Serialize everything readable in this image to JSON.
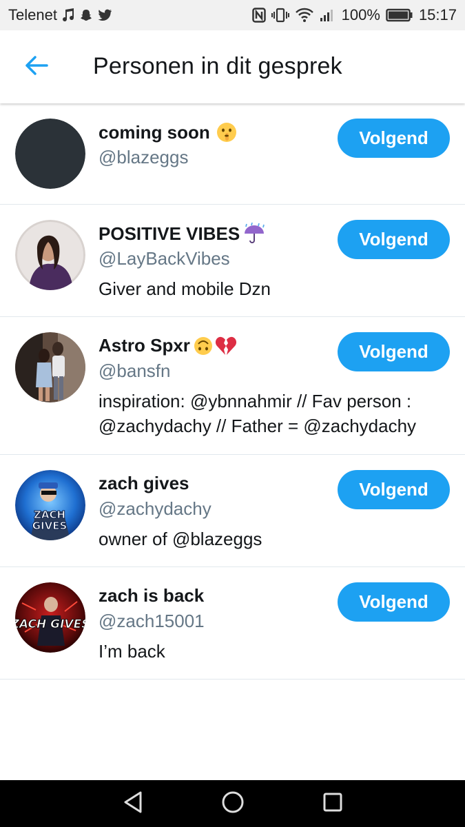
{
  "status_bar": {
    "carrier": "Telenet",
    "battery": "100%",
    "time": "15:17",
    "left_icons": [
      "music-note-icon",
      "snapchat-icon",
      "twitter-icon"
    ],
    "right_icons": [
      "nfc-icon",
      "vibrate-icon",
      "wifi-icon",
      "signal-icon",
      "battery-icon"
    ]
  },
  "header": {
    "back_icon": "arrow-left-icon",
    "title": "Personen in dit gesprek"
  },
  "colors": {
    "accent": "#1da1f2",
    "text_primary": "#14171a",
    "text_secondary": "#657786",
    "divider": "#e1e8ed"
  },
  "people": [
    {
      "name": "coming soon",
      "name_emoji": "shushing-face-emoji",
      "handle": "@blazeggs",
      "bio": "",
      "follow_label": "Volgend",
      "avatar": "dark-circle-avatar"
    },
    {
      "name": "POSITIVE VIBES",
      "name_emoji": "umbrella-rain-emoji",
      "handle": "@LayBackVibes",
      "bio": "Giver and mobile Dzn",
      "follow_label": "Volgend",
      "avatar": "photo-avatar"
    },
    {
      "name": "Astro Spxr",
      "name_emoji": "upside-down-face-broken-heart-emoji",
      "handle": "@bansfn",
      "bio": "inspiration: @ybnnahmir // Fav person : @zachydachy // Father = @zachydachy",
      "follow_label": "Volgend",
      "avatar": "photo-avatar"
    },
    {
      "name": "zach gives",
      "name_emoji": "",
      "handle": "@zachydachy",
      "bio": "owner of @blazeggs",
      "follow_label": "Volgend",
      "avatar": "game-logo-avatar",
      "avatar_text": "ZACH GIVES"
    },
    {
      "name": "zach is back",
      "name_emoji": "",
      "handle": "@zach15001",
      "bio": "I’m back",
      "follow_label": "Volgend",
      "avatar": "game-logo-avatar",
      "avatar_text": "ZACH GIVES"
    }
  ],
  "nav_bar": {
    "icons": [
      "back-triangle-icon",
      "home-circle-icon",
      "recents-square-icon"
    ]
  }
}
